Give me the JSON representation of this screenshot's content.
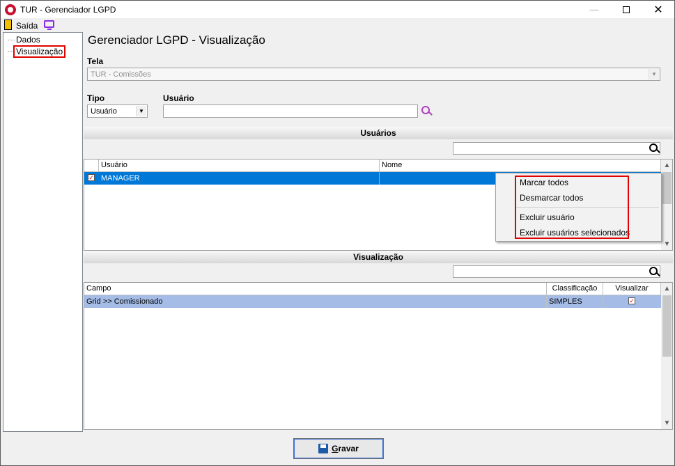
{
  "window": {
    "title": "TUR - Gerenciador LGPD",
    "minimize": "—",
    "close": "✕"
  },
  "menubar": {
    "exit_label": "Saída"
  },
  "tree": {
    "items": [
      {
        "label": "Dados"
      },
      {
        "label": "Visualização"
      }
    ]
  },
  "page_title": "Gerenciador LGPD - Visualização",
  "tela": {
    "label": "Tela",
    "value": "TUR - Comissões"
  },
  "tipo": {
    "label": "Tipo",
    "value": "Usuário"
  },
  "usuario": {
    "label": "Usuário",
    "value": ""
  },
  "usuarios_section": {
    "title": "Usuários",
    "search_value": "",
    "columns": [
      "Usuário",
      "Nome"
    ],
    "rows": [
      {
        "checked": true,
        "usuario": "MANAGER",
        "nome": ""
      }
    ]
  },
  "context_menu": {
    "items": [
      "Marcar todos",
      "Desmarcar todos",
      "Excluir usuário",
      "Excluir usuários selecionados"
    ]
  },
  "visualizacao_section": {
    "title": "Visualização",
    "search_value": "",
    "columns": [
      "Campo",
      "Classificação",
      "Visualizar"
    ],
    "rows": [
      {
        "campo": "Grid >> Comissionado",
        "classificacao": "SIMPLES",
        "visualizar": true
      }
    ]
  },
  "footer": {
    "save_first": "G",
    "save_rest": "ravar"
  },
  "colors": {
    "accent": "#0078d7",
    "selection_red": "#e00000",
    "row_selected_gray": "#a4bce6"
  }
}
